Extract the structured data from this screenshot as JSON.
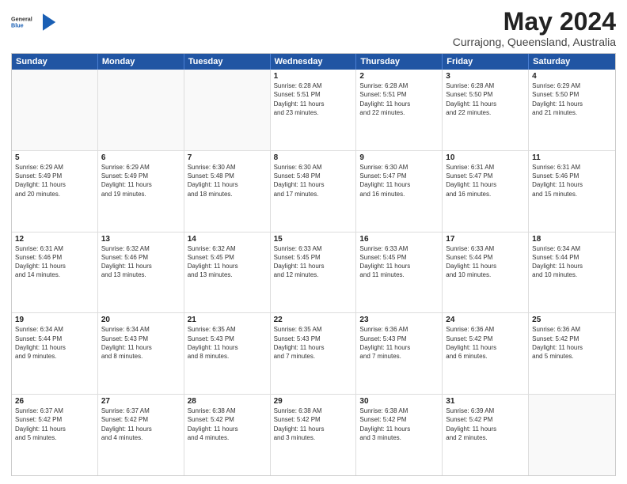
{
  "logo": {
    "general": "General",
    "blue": "Blue"
  },
  "title": {
    "month": "May 2024",
    "location": "Currajong, Queensland, Australia"
  },
  "header": {
    "days": [
      "Sunday",
      "Monday",
      "Tuesday",
      "Wednesday",
      "Thursday",
      "Friday",
      "Saturday"
    ]
  },
  "weeks": [
    [
      {
        "day": "",
        "content": "",
        "empty": true
      },
      {
        "day": "",
        "content": "",
        "empty": true
      },
      {
        "day": "",
        "content": "",
        "empty": true
      },
      {
        "day": "1",
        "content": "Sunrise: 6:28 AM\nSunset: 5:51 PM\nDaylight: 11 hours\nand 23 minutes.",
        "empty": false
      },
      {
        "day": "2",
        "content": "Sunrise: 6:28 AM\nSunset: 5:51 PM\nDaylight: 11 hours\nand 22 minutes.",
        "empty": false
      },
      {
        "day": "3",
        "content": "Sunrise: 6:28 AM\nSunset: 5:50 PM\nDaylight: 11 hours\nand 22 minutes.",
        "empty": false
      },
      {
        "day": "4",
        "content": "Sunrise: 6:29 AM\nSunset: 5:50 PM\nDaylight: 11 hours\nand 21 minutes.",
        "empty": false
      }
    ],
    [
      {
        "day": "5",
        "content": "Sunrise: 6:29 AM\nSunset: 5:49 PM\nDaylight: 11 hours\nand 20 minutes.",
        "empty": false
      },
      {
        "day": "6",
        "content": "Sunrise: 6:29 AM\nSunset: 5:49 PM\nDaylight: 11 hours\nand 19 minutes.",
        "empty": false
      },
      {
        "day": "7",
        "content": "Sunrise: 6:30 AM\nSunset: 5:48 PM\nDaylight: 11 hours\nand 18 minutes.",
        "empty": false
      },
      {
        "day": "8",
        "content": "Sunrise: 6:30 AM\nSunset: 5:48 PM\nDaylight: 11 hours\nand 17 minutes.",
        "empty": false
      },
      {
        "day": "9",
        "content": "Sunrise: 6:30 AM\nSunset: 5:47 PM\nDaylight: 11 hours\nand 16 minutes.",
        "empty": false
      },
      {
        "day": "10",
        "content": "Sunrise: 6:31 AM\nSunset: 5:47 PM\nDaylight: 11 hours\nand 16 minutes.",
        "empty": false
      },
      {
        "day": "11",
        "content": "Sunrise: 6:31 AM\nSunset: 5:46 PM\nDaylight: 11 hours\nand 15 minutes.",
        "empty": false
      }
    ],
    [
      {
        "day": "12",
        "content": "Sunrise: 6:31 AM\nSunset: 5:46 PM\nDaylight: 11 hours\nand 14 minutes.",
        "empty": false
      },
      {
        "day": "13",
        "content": "Sunrise: 6:32 AM\nSunset: 5:46 PM\nDaylight: 11 hours\nand 13 minutes.",
        "empty": false
      },
      {
        "day": "14",
        "content": "Sunrise: 6:32 AM\nSunset: 5:45 PM\nDaylight: 11 hours\nand 13 minutes.",
        "empty": false
      },
      {
        "day": "15",
        "content": "Sunrise: 6:33 AM\nSunset: 5:45 PM\nDaylight: 11 hours\nand 12 minutes.",
        "empty": false
      },
      {
        "day": "16",
        "content": "Sunrise: 6:33 AM\nSunset: 5:45 PM\nDaylight: 11 hours\nand 11 minutes.",
        "empty": false
      },
      {
        "day": "17",
        "content": "Sunrise: 6:33 AM\nSunset: 5:44 PM\nDaylight: 11 hours\nand 10 minutes.",
        "empty": false
      },
      {
        "day": "18",
        "content": "Sunrise: 6:34 AM\nSunset: 5:44 PM\nDaylight: 11 hours\nand 10 minutes.",
        "empty": false
      }
    ],
    [
      {
        "day": "19",
        "content": "Sunrise: 6:34 AM\nSunset: 5:44 PM\nDaylight: 11 hours\nand 9 minutes.",
        "empty": false
      },
      {
        "day": "20",
        "content": "Sunrise: 6:34 AM\nSunset: 5:43 PM\nDaylight: 11 hours\nand 8 minutes.",
        "empty": false
      },
      {
        "day": "21",
        "content": "Sunrise: 6:35 AM\nSunset: 5:43 PM\nDaylight: 11 hours\nand 8 minutes.",
        "empty": false
      },
      {
        "day": "22",
        "content": "Sunrise: 6:35 AM\nSunset: 5:43 PM\nDaylight: 11 hours\nand 7 minutes.",
        "empty": false
      },
      {
        "day": "23",
        "content": "Sunrise: 6:36 AM\nSunset: 5:43 PM\nDaylight: 11 hours\nand 7 minutes.",
        "empty": false
      },
      {
        "day": "24",
        "content": "Sunrise: 6:36 AM\nSunset: 5:42 PM\nDaylight: 11 hours\nand 6 minutes.",
        "empty": false
      },
      {
        "day": "25",
        "content": "Sunrise: 6:36 AM\nSunset: 5:42 PM\nDaylight: 11 hours\nand 5 minutes.",
        "empty": false
      }
    ],
    [
      {
        "day": "26",
        "content": "Sunrise: 6:37 AM\nSunset: 5:42 PM\nDaylight: 11 hours\nand 5 minutes.",
        "empty": false
      },
      {
        "day": "27",
        "content": "Sunrise: 6:37 AM\nSunset: 5:42 PM\nDaylight: 11 hours\nand 4 minutes.",
        "empty": false
      },
      {
        "day": "28",
        "content": "Sunrise: 6:38 AM\nSunset: 5:42 PM\nDaylight: 11 hours\nand 4 minutes.",
        "empty": false
      },
      {
        "day": "29",
        "content": "Sunrise: 6:38 AM\nSunset: 5:42 PM\nDaylight: 11 hours\nand 3 minutes.",
        "empty": false
      },
      {
        "day": "30",
        "content": "Sunrise: 6:38 AM\nSunset: 5:42 PM\nDaylight: 11 hours\nand 3 minutes.",
        "empty": false
      },
      {
        "day": "31",
        "content": "Sunrise: 6:39 AM\nSunset: 5:42 PM\nDaylight: 11 hours\nand 2 minutes.",
        "empty": false
      },
      {
        "day": "",
        "content": "",
        "empty": true
      }
    ]
  ]
}
